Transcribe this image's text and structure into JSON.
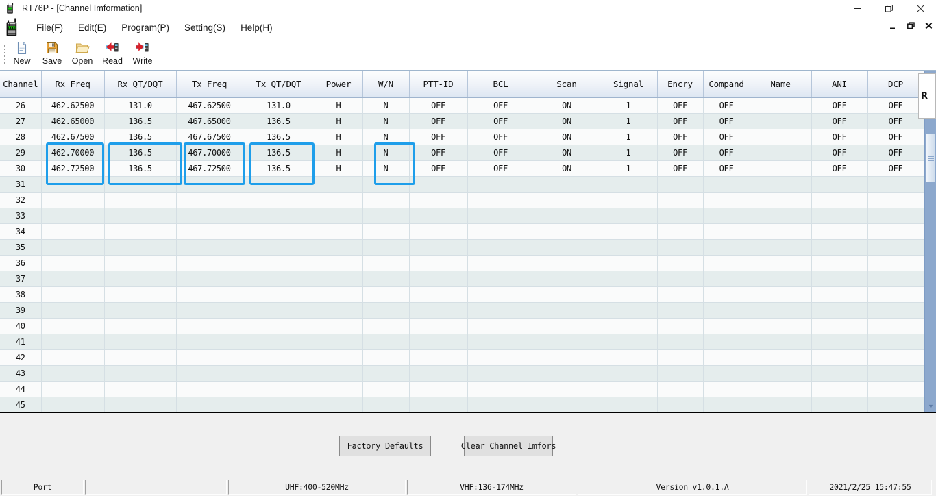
{
  "window": {
    "title": "RT76P - [Channel Imformation]",
    "app_icon": "radio-icon",
    "minimize": "—",
    "maximize": "❐",
    "close": "✕"
  },
  "mdi": {
    "minimize": "_",
    "restore": "❐",
    "close": "✕"
  },
  "menu": {
    "items": [
      {
        "label": "File(F)",
        "name": "menu-file"
      },
      {
        "label": "Edit(E)",
        "name": "menu-edit"
      },
      {
        "label": "Program(P)",
        "name": "menu-program"
      },
      {
        "label": "Setting(S)",
        "name": "menu-setting"
      },
      {
        "label": "Help(H)",
        "name": "menu-help"
      }
    ]
  },
  "toolbar": {
    "buttons": [
      {
        "label": "New",
        "icon": "new-document-icon"
      },
      {
        "label": "Save",
        "icon": "floppy-disk-icon"
      },
      {
        "label": "Open",
        "icon": "folder-open-icon"
      },
      {
        "label": "Read",
        "icon": "read-from-radio-icon"
      },
      {
        "label": "Write",
        "icon": "write-to-radio-icon"
      }
    ]
  },
  "table": {
    "columns": [
      "Channel",
      "Rx Freq",
      "Rx QT/DQT",
      "Tx Freq",
      "Tx QT/DQT",
      "Power",
      "W/N",
      "PTT-ID",
      "BCL",
      "Scan",
      "Signal",
      "Encry",
      "Compand",
      "Name",
      "ANI",
      "DCP"
    ],
    "highlighted_columns": [
      "Rx Freq",
      "Rx QT/DQT",
      "Tx Freq",
      "Tx QT/DQT",
      "W/N"
    ],
    "highlight_color": "#1e9eea",
    "rows": [
      {
        "channel": "26",
        "rx_freq": "462.62500",
        "rx_qt": "131.0",
        "tx_freq": "467.62500",
        "tx_qt": "131.0",
        "power": "H",
        "wn": "N",
        "ptt_id": "OFF",
        "bcl": "OFF",
        "scan": "ON",
        "signal": "1",
        "encry": "OFF",
        "compand": "OFF",
        "name": "",
        "ani": "OFF",
        "dcp": "OFF"
      },
      {
        "channel": "27",
        "rx_freq": "462.65000",
        "rx_qt": "136.5",
        "tx_freq": "467.65000",
        "tx_qt": "136.5",
        "power": "H",
        "wn": "N",
        "ptt_id": "OFF",
        "bcl": "OFF",
        "scan": "ON",
        "signal": "1",
        "encry": "OFF",
        "compand": "OFF",
        "name": "",
        "ani": "OFF",
        "dcp": "OFF"
      },
      {
        "channel": "28",
        "rx_freq": "462.67500",
        "rx_qt": "136.5",
        "tx_freq": "467.67500",
        "tx_qt": "136.5",
        "power": "H",
        "wn": "N",
        "ptt_id": "OFF",
        "bcl": "OFF",
        "scan": "ON",
        "signal": "1",
        "encry": "OFF",
        "compand": "OFF",
        "name": "",
        "ani": "OFF",
        "dcp": "OFF"
      },
      {
        "channel": "29",
        "rx_freq": "462.70000",
        "rx_qt": "136.5",
        "tx_freq": "467.70000",
        "tx_qt": "136.5",
        "power": "H",
        "wn": "N",
        "ptt_id": "OFF",
        "bcl": "OFF",
        "scan": "ON",
        "signal": "1",
        "encry": "OFF",
        "compand": "OFF",
        "name": "",
        "ani": "OFF",
        "dcp": "OFF"
      },
      {
        "channel": "30",
        "rx_freq": "462.72500",
        "rx_qt": "136.5",
        "tx_freq": "467.72500",
        "tx_qt": "136.5",
        "power": "H",
        "wn": "N",
        "ptt_id": "OFF",
        "bcl": "OFF",
        "scan": "ON",
        "signal": "1",
        "encry": "OFF",
        "compand": "OFF",
        "name": "",
        "ani": "OFF",
        "dcp": "OFF"
      },
      {
        "channel": "31",
        "rx_freq": "",
        "rx_qt": "",
        "tx_freq": "",
        "tx_qt": "",
        "power": "",
        "wn": "",
        "ptt_id": "",
        "bcl": "",
        "scan": "",
        "signal": "",
        "encry": "",
        "compand": "",
        "name": "",
        "ani": "",
        "dcp": ""
      },
      {
        "channel": "32",
        "rx_freq": "",
        "rx_qt": "",
        "tx_freq": "",
        "tx_qt": "",
        "power": "",
        "wn": "",
        "ptt_id": "",
        "bcl": "",
        "scan": "",
        "signal": "",
        "encry": "",
        "compand": "",
        "name": "",
        "ani": "",
        "dcp": ""
      },
      {
        "channel": "33",
        "rx_freq": "",
        "rx_qt": "",
        "tx_freq": "",
        "tx_qt": "",
        "power": "",
        "wn": "",
        "ptt_id": "",
        "bcl": "",
        "scan": "",
        "signal": "",
        "encry": "",
        "compand": "",
        "name": "",
        "ani": "",
        "dcp": ""
      },
      {
        "channel": "34",
        "rx_freq": "",
        "rx_qt": "",
        "tx_freq": "",
        "tx_qt": "",
        "power": "",
        "wn": "",
        "ptt_id": "",
        "bcl": "",
        "scan": "",
        "signal": "",
        "encry": "",
        "compand": "",
        "name": "",
        "ani": "",
        "dcp": ""
      },
      {
        "channel": "35",
        "rx_freq": "",
        "rx_qt": "",
        "tx_freq": "",
        "tx_qt": "",
        "power": "",
        "wn": "",
        "ptt_id": "",
        "bcl": "",
        "scan": "",
        "signal": "",
        "encry": "",
        "compand": "",
        "name": "",
        "ani": "",
        "dcp": ""
      },
      {
        "channel": "36",
        "rx_freq": "",
        "rx_qt": "",
        "tx_freq": "",
        "tx_qt": "",
        "power": "",
        "wn": "",
        "ptt_id": "",
        "bcl": "",
        "scan": "",
        "signal": "",
        "encry": "",
        "compand": "",
        "name": "",
        "ani": "",
        "dcp": ""
      },
      {
        "channel": "37",
        "rx_freq": "",
        "rx_qt": "",
        "tx_freq": "",
        "tx_qt": "",
        "power": "",
        "wn": "",
        "ptt_id": "",
        "bcl": "",
        "scan": "",
        "signal": "",
        "encry": "",
        "compand": "",
        "name": "",
        "ani": "",
        "dcp": ""
      },
      {
        "channel": "38",
        "rx_freq": "",
        "rx_qt": "",
        "tx_freq": "",
        "tx_qt": "",
        "power": "",
        "wn": "",
        "ptt_id": "",
        "bcl": "",
        "scan": "",
        "signal": "",
        "encry": "",
        "compand": "",
        "name": "",
        "ani": "",
        "dcp": ""
      },
      {
        "channel": "39",
        "rx_freq": "",
        "rx_qt": "",
        "tx_freq": "",
        "tx_qt": "",
        "power": "",
        "wn": "",
        "ptt_id": "",
        "bcl": "",
        "scan": "",
        "signal": "",
        "encry": "",
        "compand": "",
        "name": "",
        "ani": "",
        "dcp": ""
      },
      {
        "channel": "40",
        "rx_freq": "",
        "rx_qt": "",
        "tx_freq": "",
        "tx_qt": "",
        "power": "",
        "wn": "",
        "ptt_id": "",
        "bcl": "",
        "scan": "",
        "signal": "",
        "encry": "",
        "compand": "",
        "name": "",
        "ani": "",
        "dcp": ""
      },
      {
        "channel": "41",
        "rx_freq": "",
        "rx_qt": "",
        "tx_freq": "",
        "tx_qt": "",
        "power": "",
        "wn": "",
        "ptt_id": "",
        "bcl": "",
        "scan": "",
        "signal": "",
        "encry": "",
        "compand": "",
        "name": "",
        "ani": "",
        "dcp": ""
      },
      {
        "channel": "42",
        "rx_freq": "",
        "rx_qt": "",
        "tx_freq": "",
        "tx_qt": "",
        "power": "",
        "wn": "",
        "ptt_id": "",
        "bcl": "",
        "scan": "",
        "signal": "",
        "encry": "",
        "compand": "",
        "name": "",
        "ani": "",
        "dcp": ""
      },
      {
        "channel": "43",
        "rx_freq": "",
        "rx_qt": "",
        "tx_freq": "",
        "tx_qt": "",
        "power": "",
        "wn": "",
        "ptt_id": "",
        "bcl": "",
        "scan": "",
        "signal": "",
        "encry": "",
        "compand": "",
        "name": "",
        "ani": "",
        "dcp": ""
      },
      {
        "channel": "44",
        "rx_freq": "",
        "rx_qt": "",
        "tx_freq": "",
        "tx_qt": "",
        "power": "",
        "wn": "",
        "ptt_id": "",
        "bcl": "",
        "scan": "",
        "signal": "",
        "encry": "",
        "compand": "",
        "name": "",
        "ani": "",
        "dcp": ""
      },
      {
        "channel": "45",
        "rx_freq": "",
        "rx_qt": "",
        "tx_freq": "",
        "tx_qt": "",
        "power": "",
        "wn": "",
        "ptt_id": "",
        "bcl": "",
        "scan": "",
        "signal": "",
        "encry": "",
        "compand": "",
        "name": "",
        "ani": "",
        "dcp": ""
      }
    ]
  },
  "popup": {
    "text": "R"
  },
  "actions": {
    "factory_defaults": "Factory Defaults",
    "clear_channel_infos": "Clear Channel Imfors"
  },
  "statusbar": {
    "port_label": "Port",
    "port_value": "",
    "uhf_range": "UHF:400-520MHz",
    "vhf_range": "VHF:136-174MHz",
    "version": "Version v1.0.1.A",
    "datetime": "2021/2/25 15:47:55"
  }
}
